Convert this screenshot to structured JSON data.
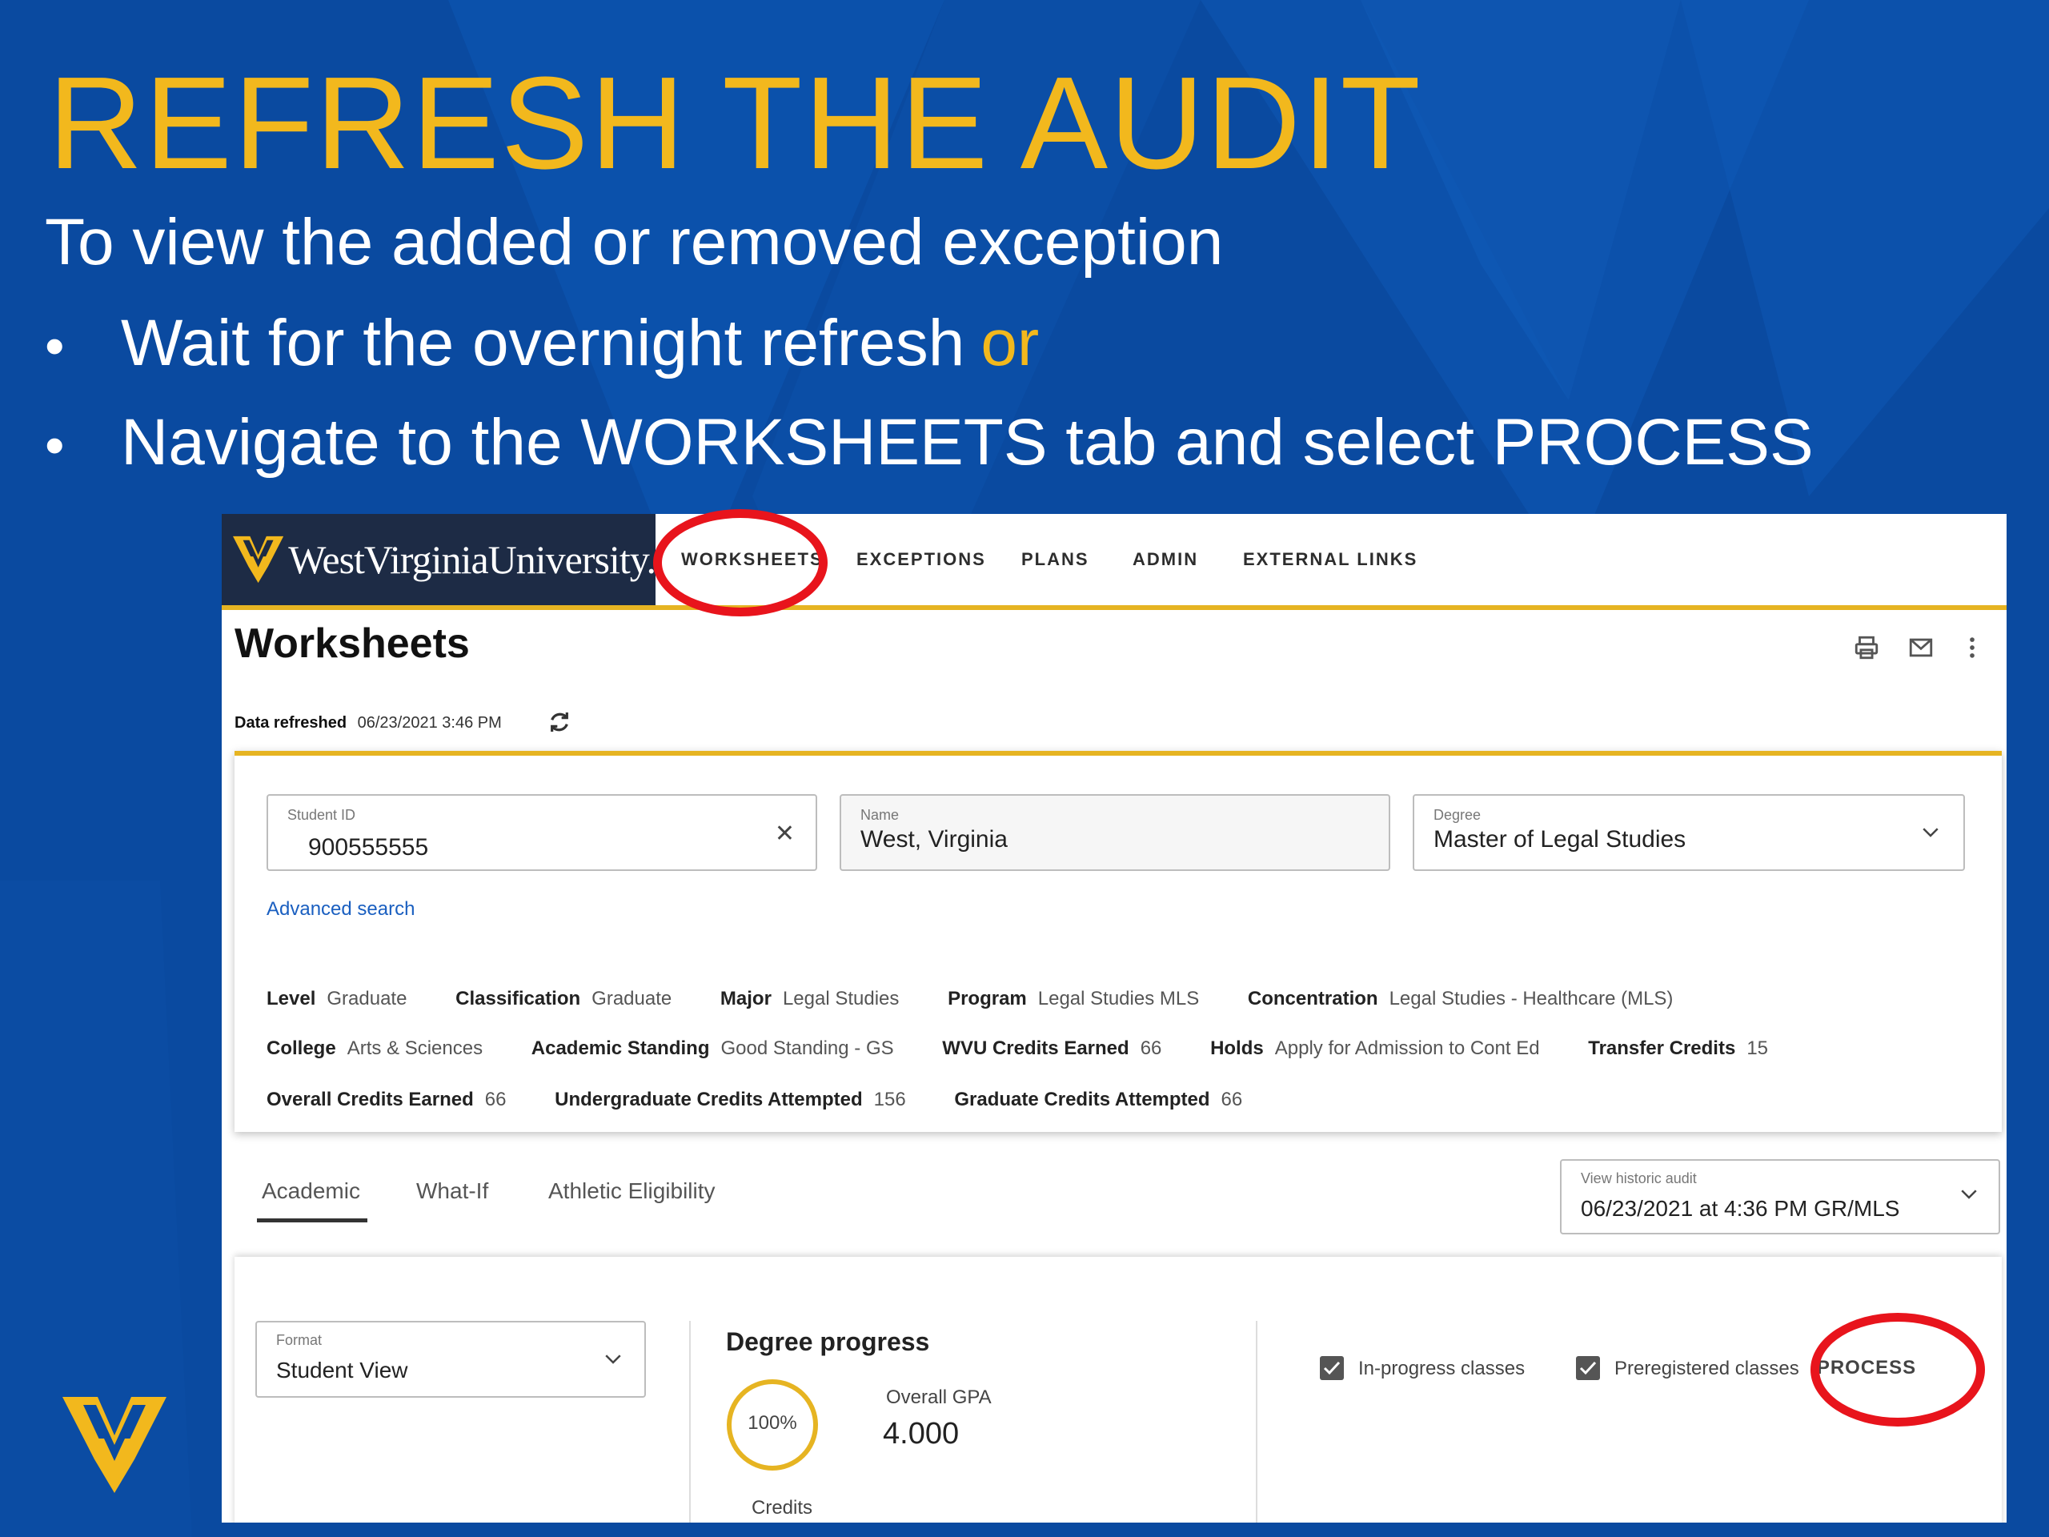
{
  "slide": {
    "title": "REFRESH THE AUDIT",
    "subtitle": "To view the added or removed exception",
    "bullets": [
      {
        "text": "Wait for the overnight refresh",
        "emphasis": "or"
      },
      {
        "text": "Navigate to the WORKSHEETS tab and select PROCESS"
      }
    ],
    "colors": {
      "background": "#0a4aa0",
      "accent": "#f2b81d",
      "callout": "#e8141c"
    }
  },
  "app": {
    "brand": "WestVirginiaUniversity.",
    "nav": [
      "WORKSHEETS",
      "EXCEPTIONS",
      "PLANS",
      "ADMIN",
      "EXTERNAL LINKS"
    ],
    "page_title": "Worksheets",
    "toolbar_icons": [
      "print-icon",
      "mail-icon",
      "more-vertical-icon"
    ],
    "data_refreshed": {
      "label": "Data refreshed",
      "value": "06/23/2021 3:46 PM"
    },
    "student": {
      "id_label": "Student ID",
      "id_value": "900555555",
      "name_label": "Name",
      "name_value": "West, Virginia",
      "degree_label": "Degree",
      "degree_value": "Master of Legal Studies"
    },
    "advanced_search": "Advanced search",
    "info_rows": [
      [
        {
          "k": "Level",
          "v": "Graduate"
        },
        {
          "k": "Classification",
          "v": "Graduate"
        },
        {
          "k": "Major",
          "v": "Legal Studies"
        },
        {
          "k": "Program",
          "v": "Legal Studies MLS"
        },
        {
          "k": "Concentration",
          "v": "Legal Studies - Healthcare (MLS)"
        }
      ],
      [
        {
          "k": "College",
          "v": "Arts & Sciences"
        },
        {
          "k": "Academic Standing",
          "v": "Good Standing - GS"
        },
        {
          "k": "WVU Credits Earned",
          "v": "66"
        },
        {
          "k": "Holds",
          "v": "Apply for Admission to Cont Ed"
        },
        {
          "k": "Transfer Credits",
          "v": "15"
        }
      ],
      [
        {
          "k": "Overall Credits Earned",
          "v": "66"
        },
        {
          "k": "Undergraduate Credits Attempted",
          "v": "156"
        },
        {
          "k": "Graduate Credits Attempted",
          "v": "66"
        }
      ]
    ],
    "tabs": [
      "Academic",
      "What-If",
      "Athletic Eligibility"
    ],
    "active_tab": "Academic",
    "historic": {
      "label": "View historic audit",
      "value": "06/23/2021 at 4:36 PM GR/MLS"
    },
    "format": {
      "label": "Format",
      "value": "Student View"
    },
    "degree_progress": {
      "title": "Degree progress",
      "percent_label": "100%",
      "percent": 100,
      "credits_label": "Credits",
      "gpa_label": "Overall GPA",
      "gpa_value": "4.000"
    },
    "checkboxes": [
      {
        "label": "In-progress classes",
        "checked": true
      },
      {
        "label": "Preregistered classes",
        "checked": true
      }
    ],
    "process_button": "PROCESS"
  }
}
